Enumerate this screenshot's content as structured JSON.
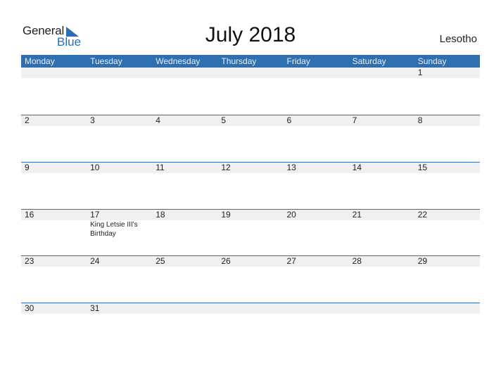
{
  "logo": {
    "general": "General",
    "blue": "Blue"
  },
  "title": "July 2018",
  "country": "Lesotho",
  "colors": {
    "accent": "#2e6fb0",
    "strip": "#f0f0f0"
  },
  "weekdays": [
    "Monday",
    "Tuesday",
    "Wednesday",
    "Thursday",
    "Friday",
    "Saturday",
    "Sunday"
  ],
  "weeks": [
    {
      "days": [
        "",
        "",
        "",
        "",
        "",
        "",
        "1"
      ],
      "events": [
        "",
        "",
        "",
        "",
        "",
        "",
        ""
      ]
    },
    {
      "days": [
        "2",
        "3",
        "4",
        "5",
        "6",
        "7",
        "8"
      ],
      "events": [
        "",
        "",
        "",
        "",
        "",
        "",
        ""
      ]
    },
    {
      "days": [
        "9",
        "10",
        "11",
        "12",
        "13",
        "14",
        "15"
      ],
      "events": [
        "",
        "",
        "",
        "",
        "",
        "",
        ""
      ]
    },
    {
      "days": [
        "16",
        "17",
        "18",
        "19",
        "20",
        "21",
        "22"
      ],
      "events": [
        "",
        "King Letsie III's Birthday",
        "",
        "",
        "",
        "",
        ""
      ]
    },
    {
      "days": [
        "23",
        "24",
        "25",
        "26",
        "27",
        "28",
        "29"
      ],
      "events": [
        "",
        "",
        "",
        "",
        "",
        "",
        ""
      ]
    },
    {
      "days": [
        "30",
        "31",
        "",
        "",
        "",
        "",
        ""
      ],
      "events": [
        "",
        "",
        "",
        "",
        "",
        "",
        ""
      ]
    }
  ]
}
